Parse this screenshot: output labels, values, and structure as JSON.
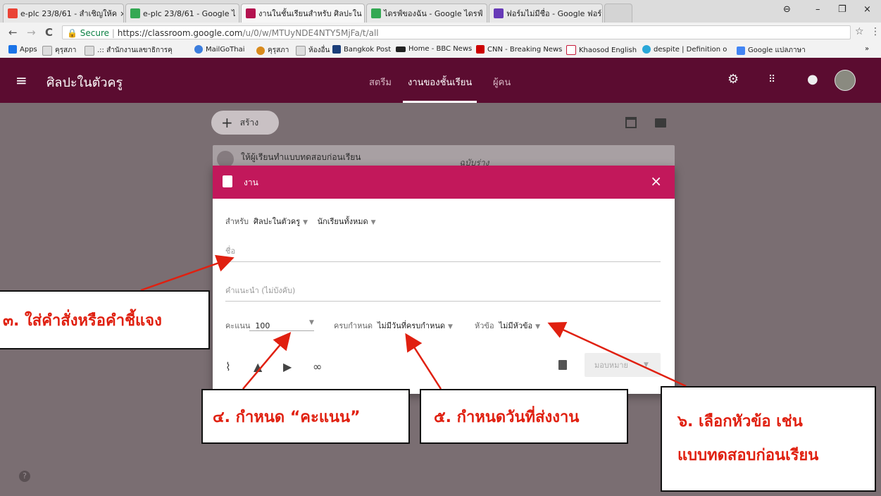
{
  "browser": {
    "tabs": [
      {
        "label": "e-plc 23/8/61 - สำเชิญให้ค"
      },
      {
        "label": "e-plc 23/8/61 - Google ไ"
      },
      {
        "label": "งานในชั้นเรียนสำหรับ ศิลปะใน"
      },
      {
        "label": "ไดรฟ์ของฉัน - Google ไดรฟ์"
      },
      {
        "label": "ฟอร์มไม่มีชื่อ - Google ฟอร์"
      }
    ],
    "tab_close": "×",
    "window_controls": {
      "minimize": "–",
      "maximize": "❐",
      "close": "×",
      "account": "⊖"
    },
    "nav": {
      "back": "←",
      "forward": "→",
      "reload": "C"
    },
    "secure_label": "Secure",
    "url_base": "https://classroom.google.com",
    "url_path": "/u/0/w/MTUyNDE4NTY5MjFa/t/all",
    "star": "☆",
    "menu": "⋮",
    "bookmarks": [
      {
        "label": "Apps",
        "color": "#1a73e8"
      },
      {
        "label": "คุรุสภา",
        "color": "#bbbbbb"
      },
      {
        "label": ".:: สำนักงานเลขาธิการคุ",
        "color": "#bbbbbb"
      },
      {
        "label": "MailGoThai",
        "color": "#3b7ddd"
      },
      {
        "label": "คุรุสภา",
        "color": "#d98a1c"
      },
      {
        "label": "ห้องอื่น",
        "color": "#bbbbbb"
      },
      {
        "label": "Bangkok Post",
        "color": "#1c3f7a"
      },
      {
        "label": "Home - BBC News",
        "color": "#222222"
      },
      {
        "label": "CNN - Breaking News",
        "color": "#cc0000"
      },
      {
        "label": "Khaosod English",
        "color": "#c61b3a"
      },
      {
        "label": "despite | Definition o",
        "color": "#2aa7d8"
      },
      {
        "label": "Google แปลภาษา",
        "color": "#4285f4"
      }
    ],
    "bookmarks_more": "»"
  },
  "appbar": {
    "menu_icon": "≡",
    "class_name": "ศิลปะในตัวครู",
    "tabs": [
      {
        "label": "สตรีม"
      },
      {
        "label": "งานของชั้นเรียน"
      },
      {
        "label": "ผู้คน"
      }
    ]
  },
  "toolbar": {
    "create_label": "สร้าง",
    "create_plus": "+"
  },
  "behind_card": {
    "title": "ให้ผู้เรียนทำแบบทดสอบก่อนเรียน",
    "status": "ฉบับร่าง"
  },
  "dialog": {
    "title": "งาน",
    "close": "×",
    "for_label": "สำหรับ",
    "class_value": "ศิลปะในตัวครู",
    "students_value": "นักเรียนทั้งหมด",
    "title_placeholder": "ชื่อ",
    "instructions_placeholder": "คำแนะนำ (ไม่บังคับ)",
    "points_label": "คะแนน",
    "points_value": "100",
    "due_label": "ครบกำหนด",
    "due_value": "ไม่มีวันที่ครบกำหนด",
    "topic_label": "หัวข้อ",
    "topic_value": "ไม่มีหัวข้อ",
    "assign_label": "มอบหมาย"
  },
  "help_icon": "?",
  "callouts": {
    "c3": "๓. ใส่คำสั่งหรือคำชี้แจง",
    "c4": "๔. กำหนด “คะแนน”",
    "c5": "๕. กำหนดวันที่ส่งงาน",
    "c6_line1": "๖. เลือกหัวข้อ เช่น",
    "c6_line2": "แบบทดสอบก่อนเรียน"
  },
  "colors": {
    "appbar": "#5b0c30",
    "dialog_header": "#c2185b",
    "callout_text": "#e02010",
    "arrow": "#e02010"
  }
}
